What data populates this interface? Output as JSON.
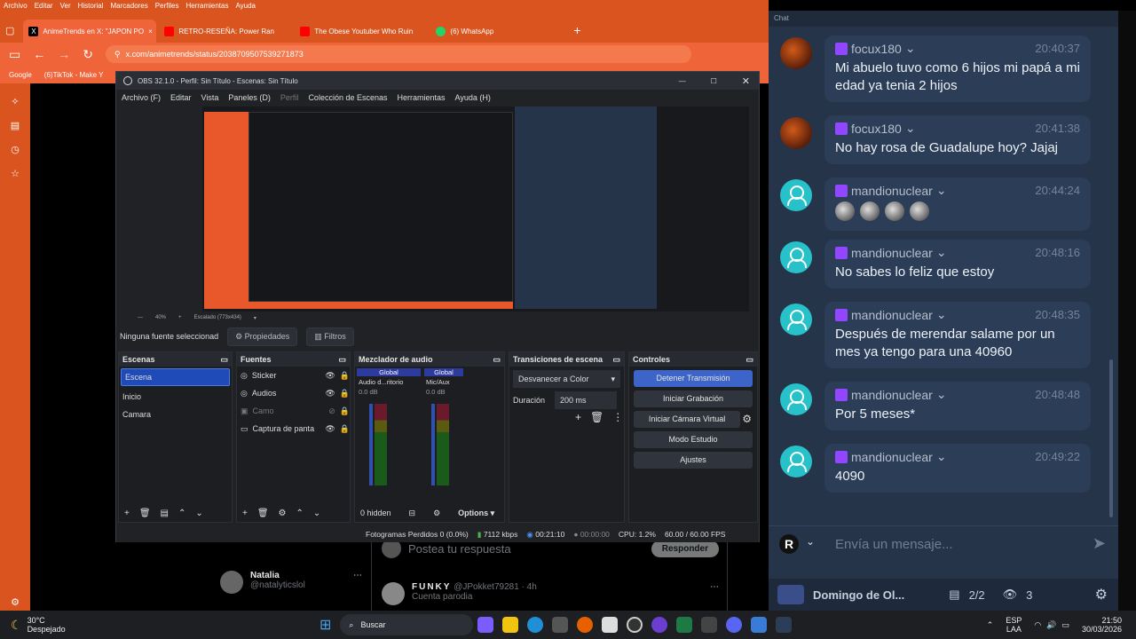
{
  "browser": {
    "menu": [
      "Archivo",
      "Editar",
      "Ver",
      "Historial",
      "Marcadores",
      "Perfiles",
      "Herramientas",
      "Ayuda"
    ],
    "tabs": [
      {
        "label": "AnimeTrends en X: \"JAPON PO"
      },
      {
        "label": "RETRO-RESEÑA: Power Ran"
      },
      {
        "label": "The Obese Youtuber Who Ruin"
      },
      {
        "label": "(6) WhatsApp"
      }
    ],
    "url": "x.com/animetrends/status/2038709507539271873",
    "bookmarks": [
      "Google",
      "(6)TikTok - Make Y"
    ]
  },
  "twitter": {
    "reply_placeholder": "Postea tu respuesta",
    "reply_button": "Responder",
    "user1_name": "Natalia",
    "user1_handle": "@natalyticslol",
    "user2_name": "FUNKY",
    "user2_handle": "@JPokket79281 · 4h",
    "user2_sub": "Cuenta parodia"
  },
  "obs": {
    "title": "OBS 32.1.0 - Perfil: Sin Título - Escenas: Sin Título",
    "menu": [
      "Archivo (F)",
      "Editar",
      "Vista",
      "Paneles (D)",
      "Perfil",
      "Colección de Escenas",
      "Herramientas",
      "Ayuda (H)"
    ],
    "zoom": "40%",
    "scaled": "Escalado (773x434)",
    "no_source": "Ninguna fuente seleccionad",
    "props": "Propiedades",
    "filters": "Filtros",
    "docks": {
      "scenes": "Escenas",
      "sources": "Fuentes",
      "mixer": "Mezclador de audio",
      "transitions": "Transiciones de escena",
      "controls": "Controles"
    },
    "scenes": [
      "Escena",
      "Inicio",
      "Camara"
    ],
    "sources": [
      "Sticker",
      "Audios",
      "Camo",
      "Captura de panta"
    ],
    "mixer": {
      "ch1_label": "Global",
      "ch1_name": "Audio d...ritorio",
      "ch1_db": "0.0 dB",
      "ch2_label": "Global",
      "ch2_name": "Mic/Aux",
      "ch2_db": "0.0 dB",
      "hidden": "0 hidden",
      "options": "Options"
    },
    "transitions": {
      "type": "Desvanecer a Color",
      "duration_label": "Duración",
      "duration": "200 ms"
    },
    "controls": [
      "Detener Transmisión",
      "Iniciar Grabación",
      "Iniciar Cámara Virtual",
      "Modo Estudio",
      "Ajustes"
    ],
    "status": {
      "dropped": "Fotogramas Perdidos 0 (0.0%)",
      "kbps": "7112 kbps",
      "stream_time": "00:21:10",
      "rec_time": "00:00:00",
      "cpu": "CPU: 1.2%",
      "fps": "60.00 / 60.00 FPS"
    }
  },
  "chat": {
    "header": "Chat",
    "messages": [
      {
        "user": "focux180",
        "time": "20:40:37",
        "text": "Mi abuelo tuvo como 6 hijos mi papá a mi edad ya tenia 2 hijos",
        "avatar": "image"
      },
      {
        "user": "focux180",
        "time": "20:41:38",
        "text": "No hay rosa de Guadalupe hoy? Jajaj",
        "avatar": "image"
      },
      {
        "user": "mandionuclear",
        "time": "20:44:24",
        "text": "",
        "avatar": "default"
      },
      {
        "user": "mandionuclear",
        "time": "20:48:16",
        "text": "No sabes lo feliz que estoy",
        "avatar": "default"
      },
      {
        "user": "mandionuclear",
        "time": "20:48:35",
        "text": "Después de merendar salame por un mes ya tengo para una 40960",
        "avatar": "default"
      },
      {
        "user": "mandionuclear",
        "time": "20:48:48",
        "text": "Por 5 meses*",
        "avatar": "default"
      },
      {
        "user": "mandionuclear",
        "time": "20:49:22",
        "text": "4090",
        "avatar": "default"
      }
    ],
    "input_placeholder": "Envía un mensaje...",
    "channel": "Domingo de Ol...",
    "count1": "2/2",
    "viewers": "3"
  },
  "taskbar": {
    "weather_temp": "30°C",
    "weather_desc": "Despejado",
    "search": "Buscar",
    "lang1": "ESP",
    "lang2": "LAA",
    "time": "21:50",
    "date": "30/03/2026"
  }
}
